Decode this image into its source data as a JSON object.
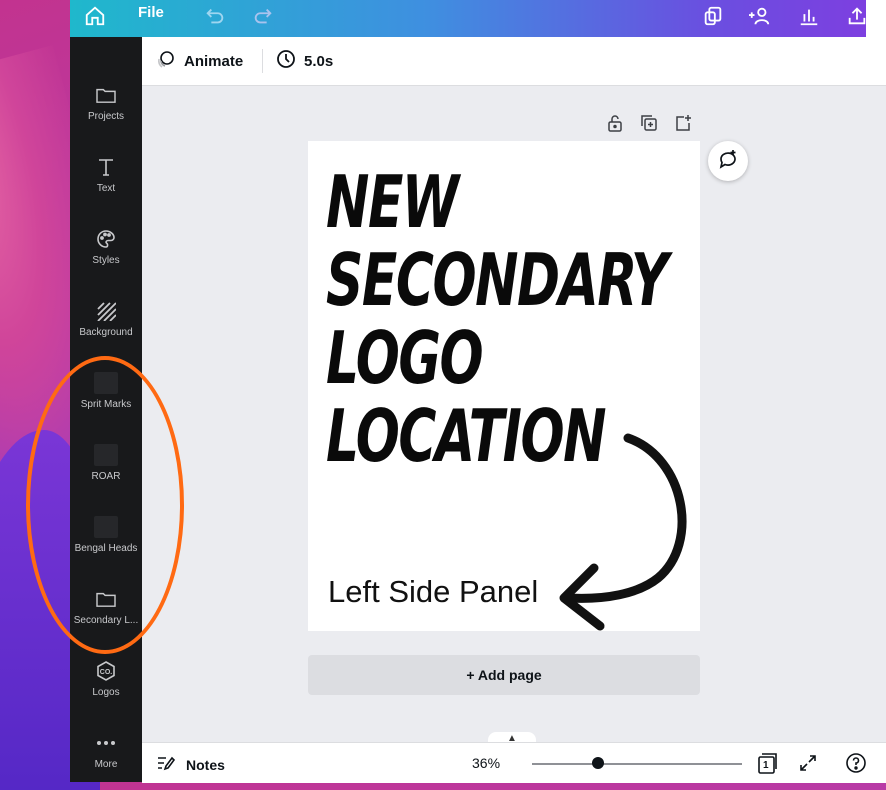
{
  "topbar": {
    "file_label": "File"
  },
  "toolbar": {
    "animate_label": "Animate",
    "duration_label": "5.0s"
  },
  "sidebar": {
    "items": [
      {
        "label": "Projects",
        "icon": "folder-icon"
      },
      {
        "label": "Text",
        "icon": "text-icon"
      },
      {
        "label": "Styles",
        "icon": "palette-icon"
      },
      {
        "label": "Background",
        "icon": "background-hatch-icon"
      },
      {
        "label": "Sprit Marks",
        "icon": "folder-thumbnail"
      },
      {
        "label": "ROAR",
        "icon": "folder-thumbnail"
      },
      {
        "label": "Bengal Heads",
        "icon": "folder-thumbnail"
      },
      {
        "label": "Secondary L...",
        "icon": "folder-icon"
      },
      {
        "label": "Logos",
        "icon": "logos-co-icon"
      },
      {
        "label": "More",
        "icon": "more-dots-icon"
      }
    ]
  },
  "canvas": {
    "headline_lines": [
      "NEW",
      "SECONDARY",
      "LOGO",
      "LOCATION"
    ],
    "subline": "Left Side Panel",
    "add_page_label": "+ Add page"
  },
  "bottombar": {
    "notes_label": "Notes",
    "zoom": "36%",
    "zoom_level": 0.36,
    "page_count": "1"
  },
  "colors": {
    "annotation_ring": "#ff6a13",
    "sidebar_bg": "#18191b"
  }
}
